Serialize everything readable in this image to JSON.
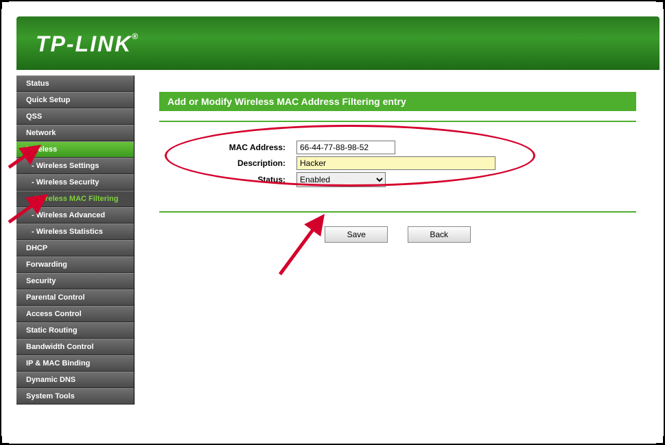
{
  "brand": "TP-LINK",
  "sidebar": {
    "items": [
      {
        "label": "Status",
        "type": "main"
      },
      {
        "label": "Quick Setup",
        "type": "main"
      },
      {
        "label": "QSS",
        "type": "main"
      },
      {
        "label": "Network",
        "type": "main"
      },
      {
        "label": "Wireless",
        "type": "active"
      },
      {
        "label": "- Wireless Settings",
        "type": "sub"
      },
      {
        "label": "- Wireless Security",
        "type": "sub"
      },
      {
        "label": "- Wireless MAC Filtering",
        "type": "sub-active"
      },
      {
        "label": "- Wireless Advanced",
        "type": "sub"
      },
      {
        "label": "- Wireless Statistics",
        "type": "sub"
      },
      {
        "label": "DHCP",
        "type": "main"
      },
      {
        "label": "Forwarding",
        "type": "main"
      },
      {
        "label": "Security",
        "type": "main"
      },
      {
        "label": "Parental Control",
        "type": "main"
      },
      {
        "label": "Access Control",
        "type": "main"
      },
      {
        "label": "Static Routing",
        "type": "main"
      },
      {
        "label": "Bandwidth Control",
        "type": "main"
      },
      {
        "label": "IP & MAC Binding",
        "type": "main"
      },
      {
        "label": "Dynamic DNS",
        "type": "main"
      },
      {
        "label": "System Tools",
        "type": "main"
      }
    ]
  },
  "page": {
    "title": "Add or Modify Wireless MAC Address Filtering entry",
    "fields": {
      "mac_label": "MAC Address:",
      "mac_value": "66-44-77-88-98-52",
      "desc_label": "Description:",
      "desc_value": "Hacker",
      "status_label": "Status:",
      "status_value": "Enabled"
    },
    "buttons": {
      "save": "Save",
      "back": "Back"
    }
  }
}
